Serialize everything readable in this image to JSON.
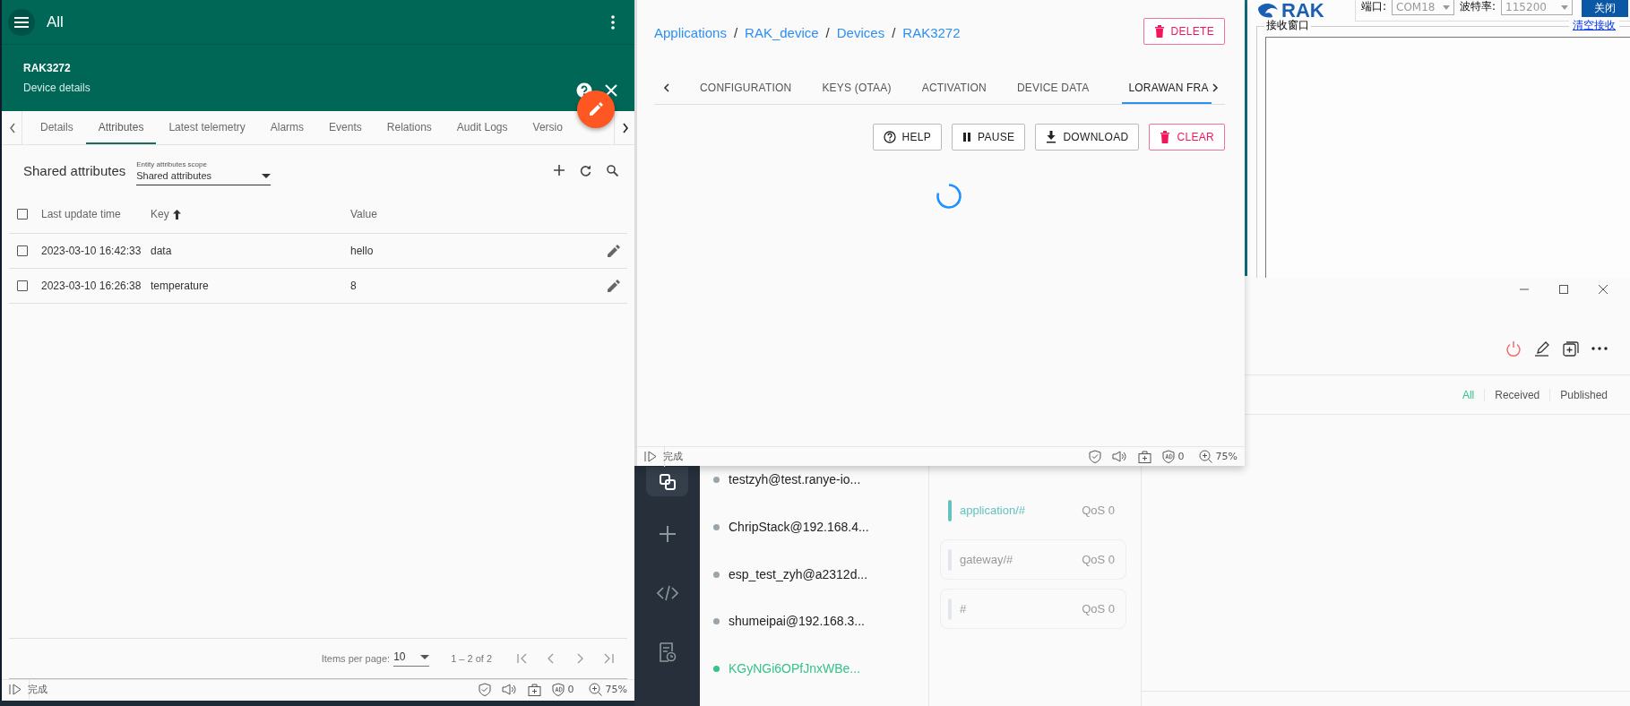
{
  "thingsboard": {
    "title": "All",
    "entity_name": "RAK3272",
    "entity_subtitle": "Device details",
    "tabs": [
      {
        "label": "Details",
        "selected": false
      },
      {
        "label": "Attributes",
        "selected": true
      },
      {
        "label": "Latest telemetry",
        "selected": false
      },
      {
        "label": "Alarms",
        "selected": false
      },
      {
        "label": "Events",
        "selected": false
      },
      {
        "label": "Relations",
        "selected": false
      },
      {
        "label": "Audit Logs",
        "selected": false
      },
      {
        "label": "Versio",
        "selected": false
      }
    ],
    "section_title": "Shared attributes",
    "scope": {
      "label": "Entity attributes scope",
      "value": "Shared attributes"
    },
    "select_all": {
      "checked": false
    },
    "columns": [
      {
        "label": "Last update time",
        "sorted": false
      },
      {
        "label": "Key",
        "sorted": true
      },
      {
        "label": "Value",
        "sorted": false
      }
    ],
    "rows": [
      {
        "checked": false,
        "time": "2023-03-10 16:42:33",
        "key": "data",
        "value": "hello"
      },
      {
        "checked": false,
        "time": "2023-03-10 16:26:38",
        "key": "temperature",
        "value": "8"
      }
    ],
    "pagination": {
      "label": "Items per page:",
      "page_size": "10",
      "range": "1 – 2 of 2"
    },
    "status_bar": {
      "text": "完成",
      "ad_count": "0",
      "zoom": "75%"
    }
  },
  "chirpstack": {
    "breadcrumb": [
      {
        "kind": "link",
        "label": "Applications"
      },
      {
        "kind": "separator",
        "label": "/"
      },
      {
        "kind": "link",
        "label": "RAK_device"
      },
      {
        "kind": "separator",
        "label": "/"
      },
      {
        "kind": "link",
        "label": "Devices"
      },
      {
        "kind": "separator",
        "label": "/"
      },
      {
        "kind": "link",
        "label": "RAK3272"
      }
    ],
    "delete_button": "DELETE",
    "tabs": [
      {
        "label": "CONFIGURATION",
        "selected": false
      },
      {
        "label": "KEYS (OTAA)",
        "selected": false
      },
      {
        "label": "ACTIVATION",
        "selected": false
      },
      {
        "label": "DEVICE DATA",
        "selected": false
      },
      {
        "label": "LORAWAN FRA",
        "selected": true
      }
    ],
    "actions": [
      {
        "kind": "help",
        "label": "HELP"
      },
      {
        "kind": "pause",
        "label": "PAUSE"
      },
      {
        "kind": "download",
        "label": "DOWNLOAD"
      },
      {
        "kind": "clear",
        "label": "CLEAR"
      }
    ],
    "loading": true,
    "status_bar": {
      "text": "完成",
      "ad_count": "0",
      "zoom": "75%"
    }
  },
  "serial": {
    "logo": "RAK",
    "port_label": "端口:",
    "port": "COM18",
    "baud_label": "波特率:",
    "baud": "115200",
    "close_button": "关闭",
    "receive_label": "接收窗口",
    "clear_link": "清空接收"
  },
  "mqttx": {
    "connections": [
      {
        "name": "testzyh@test.ranye-io...",
        "selected": false
      },
      {
        "name": "ChripStack@192.168.4...",
        "selected": false
      },
      {
        "name": "esp_test_zyh@a2312d...",
        "selected": false
      },
      {
        "name": "shumeipai@192.168.3...",
        "selected": false
      },
      {
        "name": "KGyNGi6OPfJnxWBe...",
        "selected": true
      }
    ],
    "subscriptions": [
      {
        "topic": "application/#",
        "qos": "QoS 0",
        "color": "#62c3c0",
        "selected": true
      },
      {
        "topic": "gateway/#",
        "qos": "QoS 0",
        "color": "#e3e6ef",
        "selected": false
      },
      {
        "topic": "#",
        "qos": "QoS 0",
        "color": "#e3e6ef",
        "selected": false
      }
    ],
    "message_filters": [
      {
        "label": "All",
        "selected": true
      },
      {
        "label": "Received",
        "selected": false
      },
      {
        "label": "Published",
        "selected": false
      }
    ]
  }
}
